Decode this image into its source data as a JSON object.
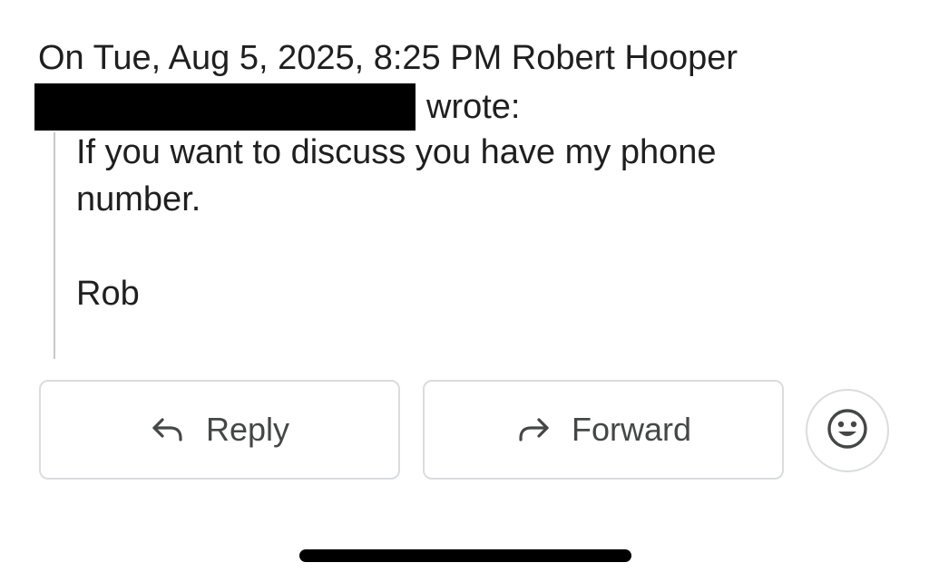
{
  "quote_header": {
    "line1": "On Tue, Aug 5, 2025, 8:25 PM Robert Hooper",
    "line2_suffix": "wrote:"
  },
  "quoted_message": {
    "body": "If you want to discuss you have my phone number.",
    "signature": "Rob"
  },
  "actions": {
    "reply_label": "Reply",
    "reply_icon": "reply-arrow-icon",
    "forward_label": "Forward",
    "forward_icon": "forward-arrow-icon",
    "emoji_icon": "smiley-face-icon"
  },
  "colors": {
    "text": "#1f1f1f",
    "button_text": "#444746",
    "button_border": "#dadce0",
    "quote_bar": "#c8c8c8",
    "redaction": "#000000"
  }
}
